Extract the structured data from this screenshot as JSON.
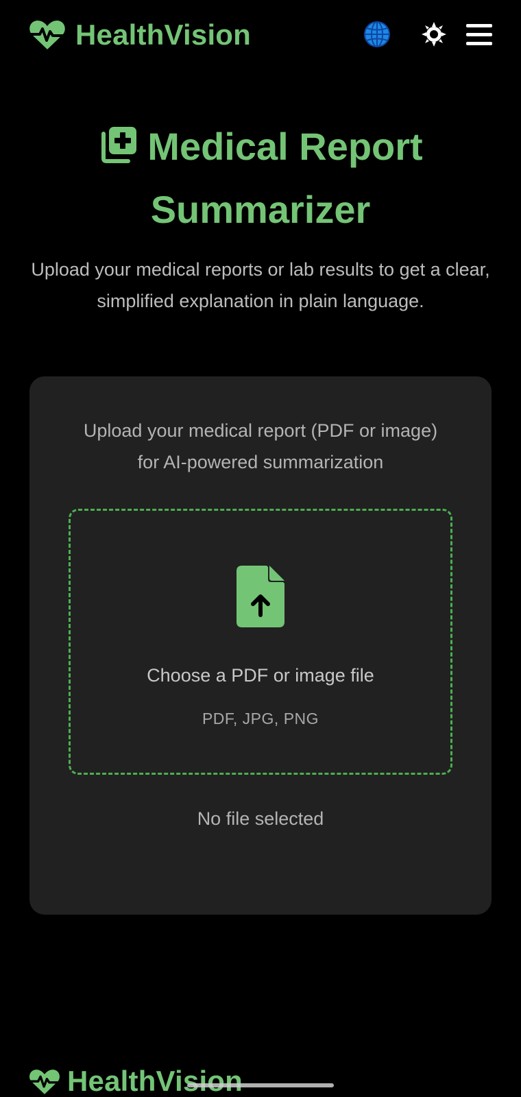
{
  "app": {
    "brand_name": "HealthVision",
    "accent_color": "#74c476",
    "background_color": "#000000",
    "card_color": "#212121"
  },
  "header": {
    "icons": [
      "heartbeat-icon",
      "globe-icon",
      "sun-icon",
      "menu-icon"
    ]
  },
  "hero": {
    "title": "Medical Report Summarizer",
    "title_icon": "medical-copy-icon",
    "subtitle": "Upload your medical reports or lab results to get a clear, simplified explanation in plain language."
  },
  "upload_card": {
    "description": "Upload your medical report (PDF or image) for AI-powered summarization",
    "dropzone": {
      "icon": "file-upload-icon",
      "label": "Choose a PDF or image file",
      "formats": "PDF, JPG, PNG"
    },
    "file_status": "No file selected"
  },
  "footer": {
    "brand_name": "HealthVision"
  }
}
